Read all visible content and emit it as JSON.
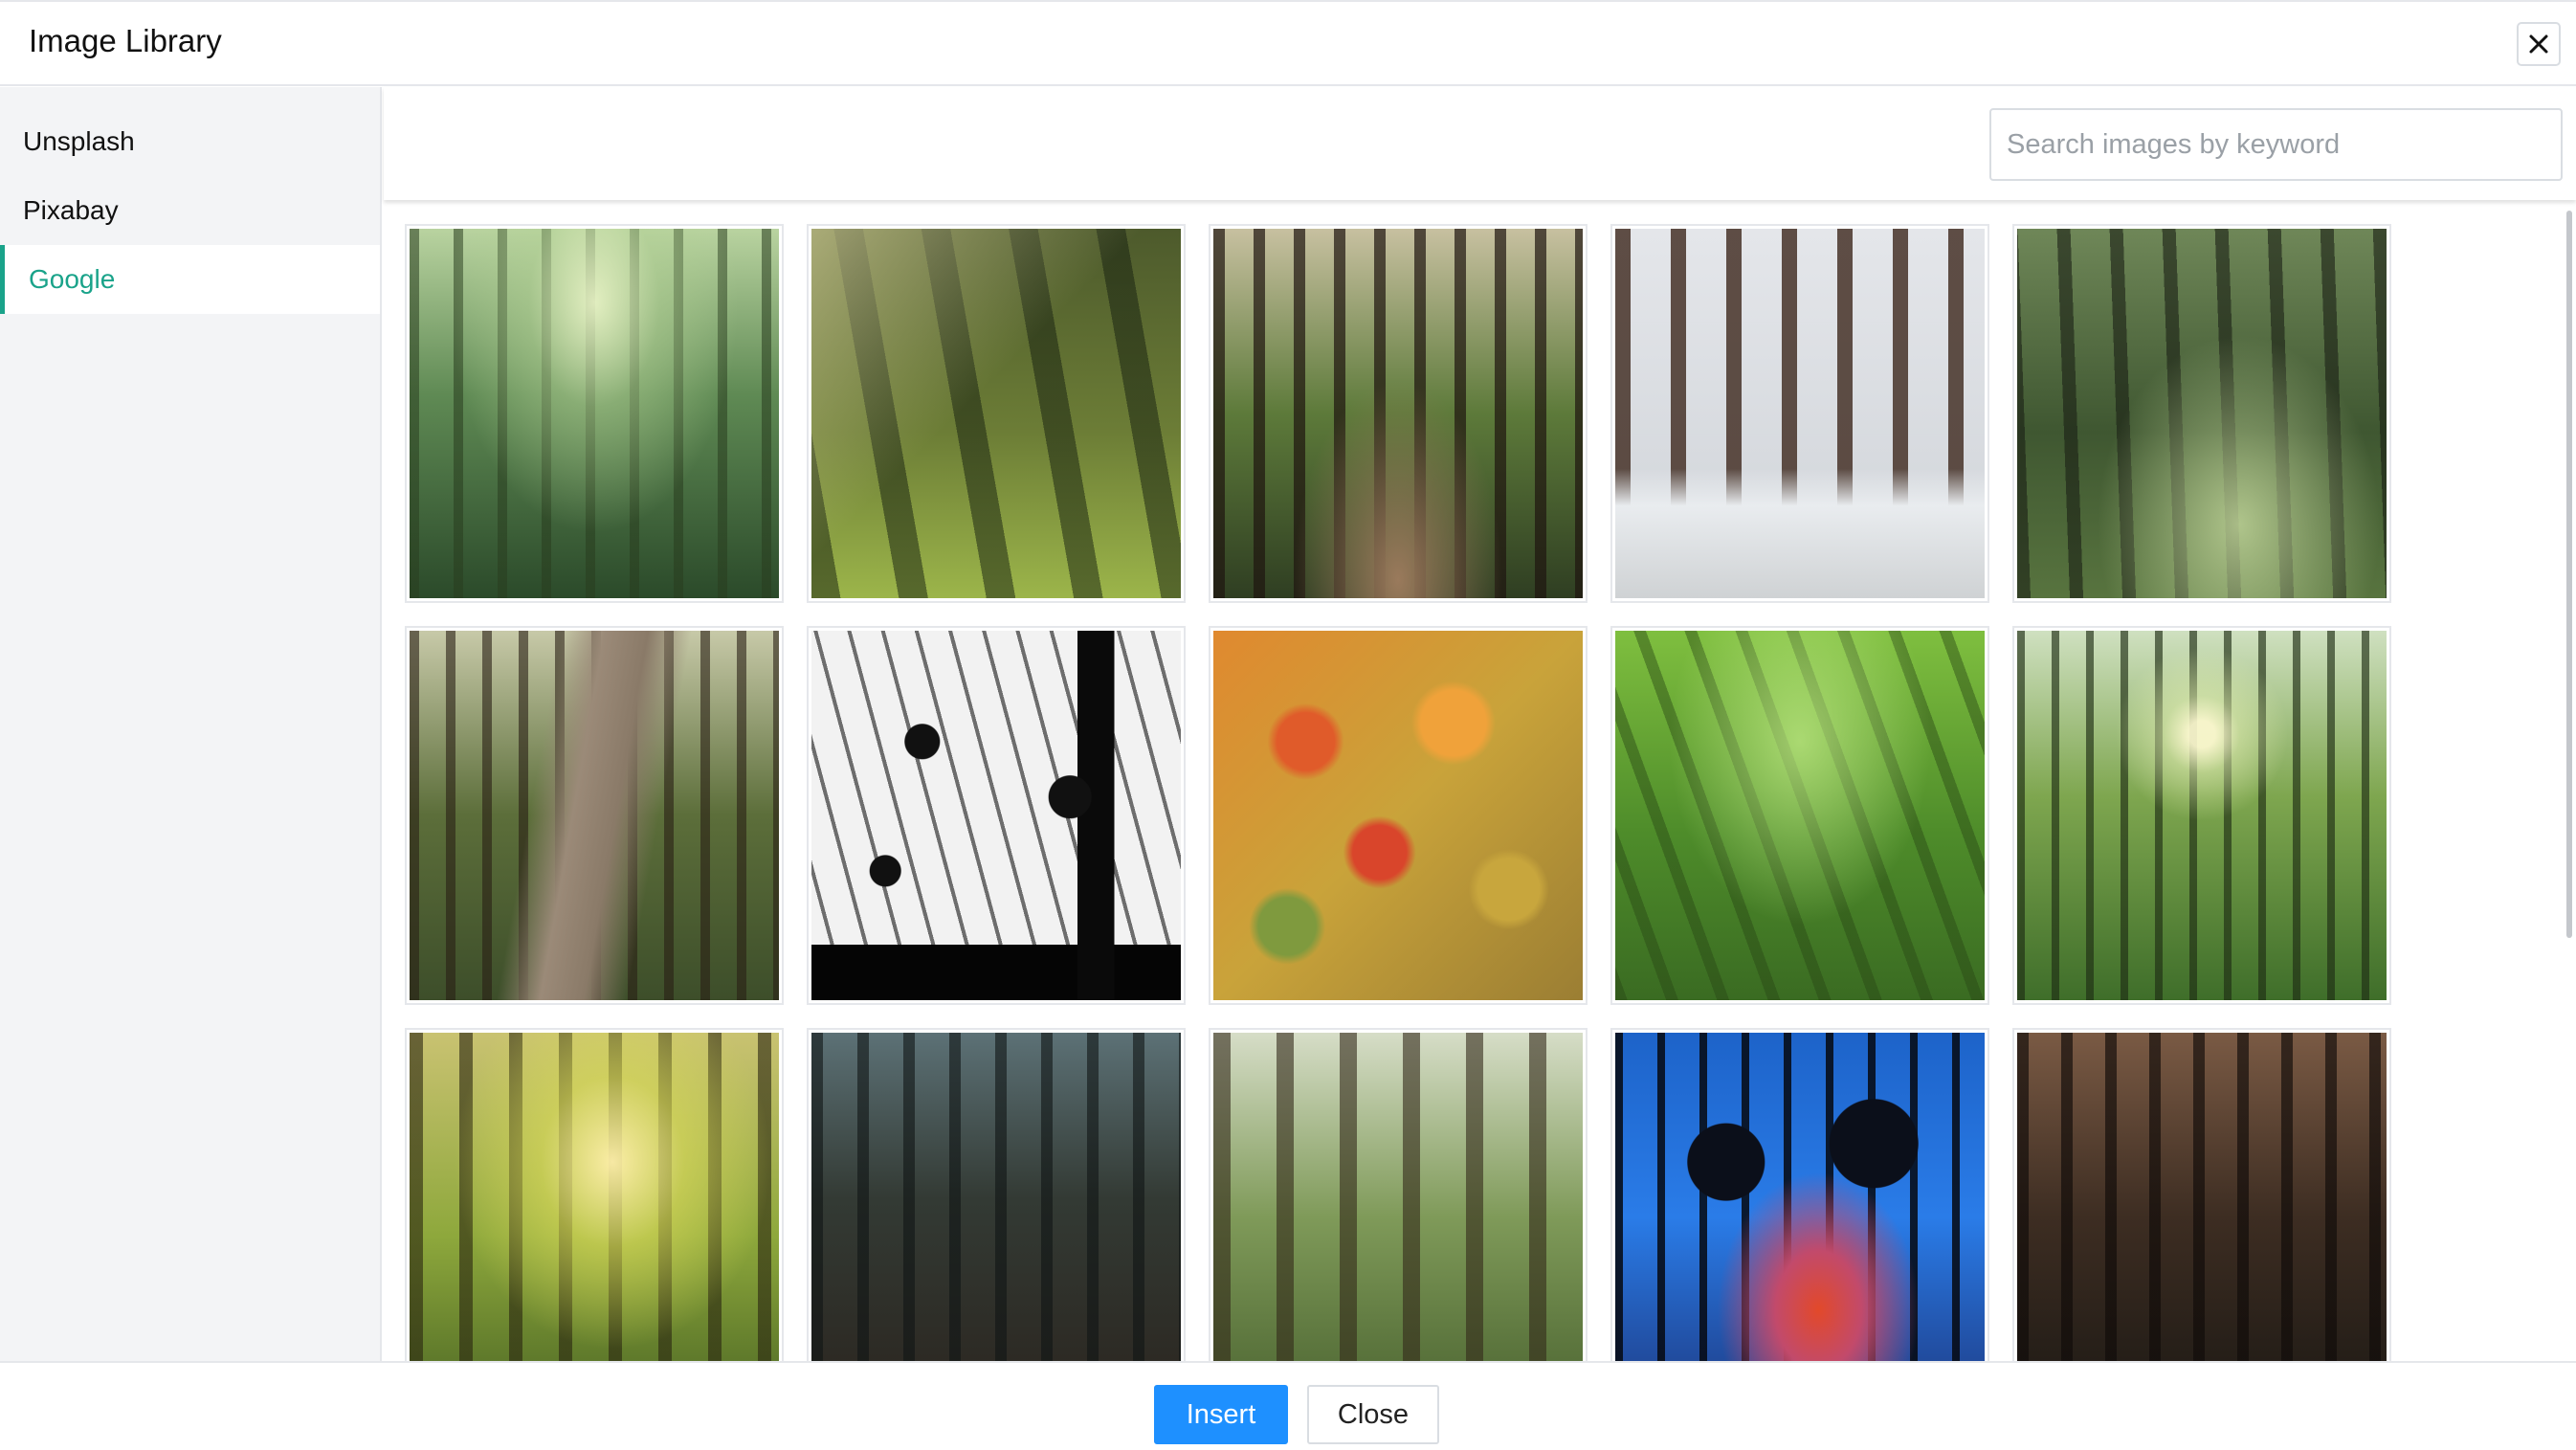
{
  "dialog": {
    "title": "Image Library"
  },
  "sidebar": {
    "items": [
      {
        "label": "Unsplash",
        "active": false
      },
      {
        "label": "Pixabay",
        "active": false
      },
      {
        "label": "Google",
        "active": true
      }
    ]
  },
  "search": {
    "placeholder": "Search images by keyword",
    "value": ""
  },
  "results": {
    "images": [
      {
        "description": "sunlit green forest with stream"
      },
      {
        "description": "sun rays through dense forest"
      },
      {
        "description": "forest path with tall pines"
      },
      {
        "description": "snowy winter forest"
      },
      {
        "description": "mossy forest floor"
      },
      {
        "description": "dirt road through forest"
      },
      {
        "description": "black and white tree silhouettes"
      },
      {
        "description": "autumn forest canopy aerial"
      },
      {
        "description": "bright green jungle"
      },
      {
        "description": "sunlit birch forest"
      },
      {
        "description": "golden light in forest"
      },
      {
        "description": "dark misty forest"
      },
      {
        "description": "tall green forest trees"
      },
      {
        "description": "tree silhouettes at blue dusk"
      },
      {
        "description": "dark brown forest"
      }
    ]
  },
  "footer": {
    "insert_label": "Insert",
    "close_label": "Close"
  },
  "colors": {
    "accent": "#1aa38a",
    "primary_button": "#1e90ff",
    "border": "#e5e7eb",
    "sidebar_bg": "#f3f4f6"
  },
  "icons": {
    "close": "close-icon"
  }
}
